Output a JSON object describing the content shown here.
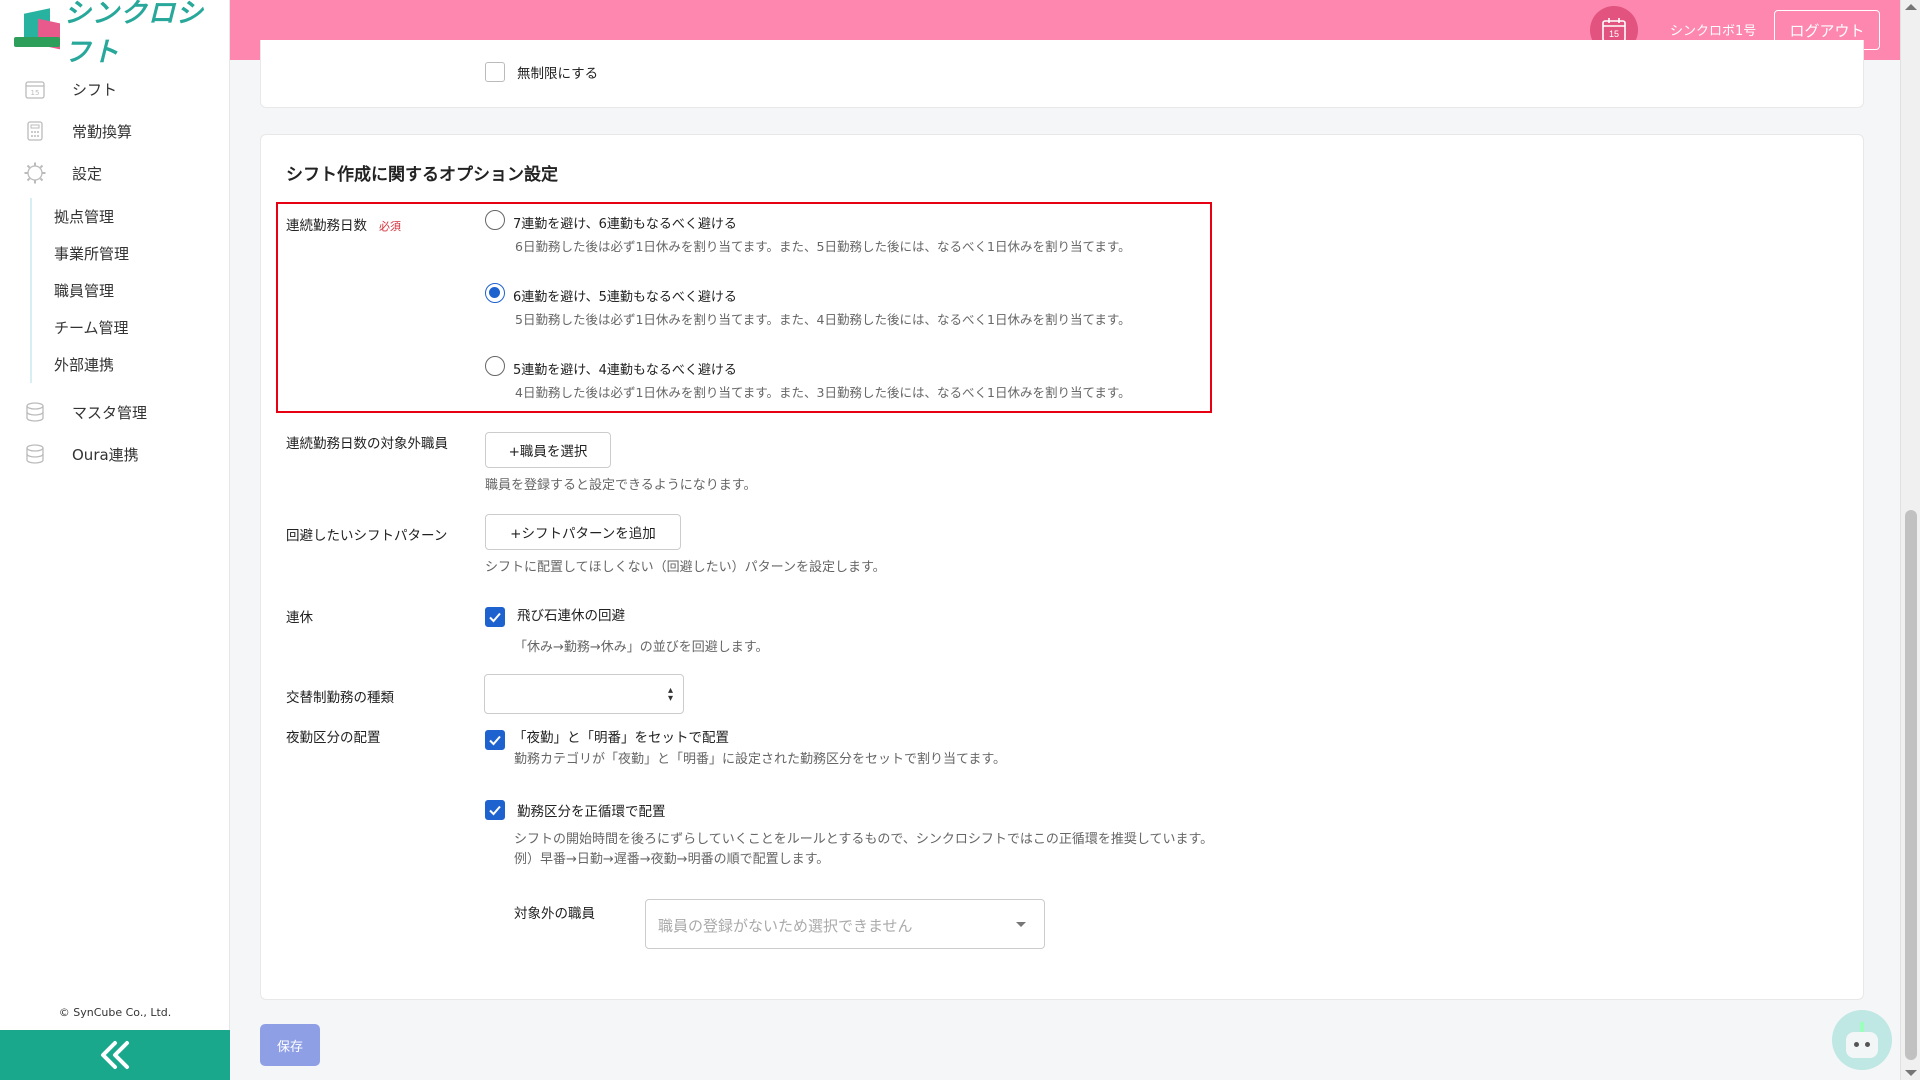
{
  "app": {
    "logo_text": "シンクロシフト"
  },
  "sidebar": {
    "items": [
      {
        "label": "シフト",
        "icon": "calendar-icon"
      },
      {
        "label": "常勤換算",
        "icon": "calculator-icon"
      },
      {
        "label": "設定",
        "icon": "gear-icon"
      }
    ],
    "sub_items": [
      "拠点管理",
      "事業所管理",
      "職員管理",
      "チーム管理",
      "外部連携"
    ],
    "bottom_items": [
      {
        "label": "マスタ管理",
        "icon": "database-icon"
      },
      {
        "label": "Oura連携",
        "icon": "database-icon"
      }
    ],
    "copyright": "© SynCube Co., Ltd."
  },
  "header": {
    "calendar_day": "15",
    "user_name": "シンクロボ1号",
    "logout_label": "ログアウト"
  },
  "top_card": {
    "unlimited_label": "無制限にする",
    "unlimited_checked": false
  },
  "options": {
    "title": "シフト作成に関するオプション設定",
    "consecutive": {
      "label": "連続勤務日数",
      "required_badge": "必須",
      "options": [
        {
          "title": "7連勤を避け、6連勤もなるべく避ける",
          "desc": "6日勤務した後は必ず1日休みを割り当てます。また、5日勤務した後には、なるべく1日休みを割り当てます。",
          "selected": false
        },
        {
          "title": "6連勤を避け、5連勤もなるべく避ける",
          "desc": "5日勤務した後は必ず1日休みを割り当てます。また、4日勤務した後には、なるべく1日休みを割り当てます。",
          "selected": true
        },
        {
          "title": "5連勤を避け、4連勤もなるべく避ける",
          "desc": "4日勤務した後は必ず1日休みを割り当てます。また、3日勤務した後には、なるべく1日休みを割り当てます。",
          "selected": false
        }
      ]
    },
    "excluded_staff": {
      "label": "連続勤務日数の対象外職員",
      "button": "+職員を選択",
      "hint": "職員を登録すると設定できるようになります。"
    },
    "avoid_pattern": {
      "label": "回避したいシフトパターン",
      "button": "+シフトパターンを追加",
      "hint": "シフトに配置してほしくない（回避したい）パターンを設定します。"
    },
    "holiday": {
      "label": "連休",
      "checkbox": "飛び石連休の回避",
      "checked": true,
      "hint": "「休み→勤務→休み」の並びを回避します。"
    },
    "rotation": {
      "label": "交替制勤務の種類",
      "value": ""
    },
    "night": {
      "label": "夜勤区分の配置",
      "checkbox": "「夜勤」と「明番」をセットで配置",
      "checked": true,
      "hint": "勤務カテゴリが「夜勤」と「明番」に設定された勤務区分をセットで割り当てます。"
    },
    "forward": {
      "checkbox": "勤務区分を正循環で配置",
      "checked": true,
      "hint1": "シフトの開始時間を後ろにずらしていくことをルールとするもので、シンクロシフトではこの正循環を推奨しています。",
      "hint2": "例）早番→日勤→遅番→夜勤→明番の順で配置します。",
      "exclude_label": "対象外の職員",
      "exclude_placeholder": "職員の登録がないため選択できません"
    }
  },
  "save_label": "保存",
  "colors": {
    "header": "#fd87af",
    "accent": "#1aa88c",
    "primary": "#1e62d0",
    "highlight": "#e60012"
  }
}
